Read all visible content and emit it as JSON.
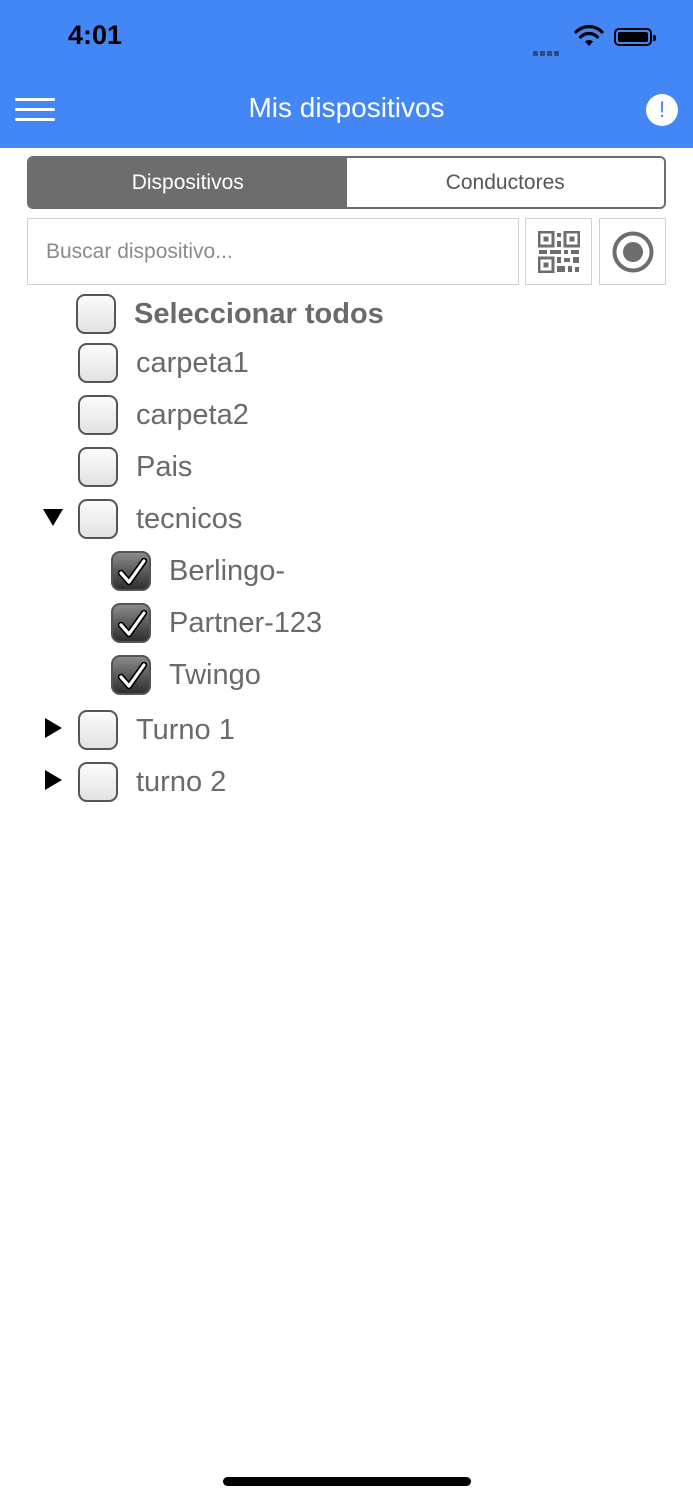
{
  "status_bar": {
    "time": "4:01"
  },
  "header": {
    "title": "Mis dispositivos",
    "info_glyph": "!"
  },
  "tabs": [
    {
      "label": "Dispositivos",
      "active": true
    },
    {
      "label": "Conductores",
      "active": false
    }
  ],
  "search": {
    "placeholder": "Buscar dispositivo...",
    "value": ""
  },
  "select_all": {
    "label": "Seleccionar todos",
    "checked": false
  },
  "tree": [
    {
      "label": "carpeta1",
      "checked": false
    },
    {
      "label": "carpeta2",
      "checked": false
    },
    {
      "label": "Pais",
      "checked": false
    },
    {
      "label": "tecnicos",
      "checked": false,
      "expanded": true,
      "children": [
        {
          "label": "Berlingo-",
          "checked": true
        },
        {
          "label": "Partner-123",
          "checked": true
        },
        {
          "label": "Twingo",
          "checked": true
        }
      ]
    },
    {
      "label": "Turno 1",
      "checked": false,
      "expanded": false
    },
    {
      "label": "turno 2",
      "checked": false,
      "expanded": false
    }
  ],
  "colors": {
    "header": "#4287F5",
    "segment": "#6d6d6d",
    "label": "#6a6a6a"
  }
}
